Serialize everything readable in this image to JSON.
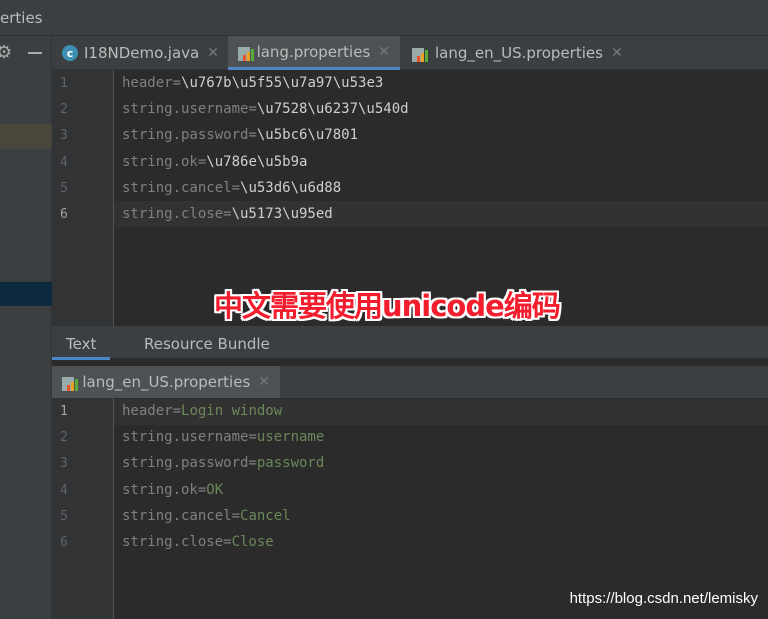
{
  "window": {
    "title": "erties"
  },
  "editor_tabs": [
    {
      "label": "I18NDemo.java",
      "icon": "java-class-icon",
      "active": false
    },
    {
      "label": "lang.properties",
      "icon": "properties-file-icon",
      "active": true
    },
    {
      "label": "lang_en_US.properties",
      "icon": "properties-file-icon",
      "active": false
    }
  ],
  "top_editor": {
    "lines": [
      {
        "n": "1",
        "key": "header=",
        "val": "\\u767b\\u5f55\\u7a97\\u53e3"
      },
      {
        "n": "2",
        "key": "string.username=",
        "val": "\\u7528\\u6237\\u540d"
      },
      {
        "n": "3",
        "key": "string.password=",
        "val": "\\u5bc6\\u7801"
      },
      {
        "n": "4",
        "key": "string.ok=",
        "val": "\\u786e\\u5b9a"
      },
      {
        "n": "5",
        "key": "string.cancel=",
        "val": "\\u53d6\\u6d88"
      },
      {
        "n": "6",
        "key": "string.close=",
        "val": "\\u5173\\u95ed"
      }
    ]
  },
  "bottom_tabs": [
    {
      "label": "Text",
      "active": true
    },
    {
      "label": "Resource Bundle",
      "active": false
    }
  ],
  "bottom_file_tab": {
    "label": "lang_en_US.properties"
  },
  "bottom_editor": {
    "lines": [
      {
        "n": "1",
        "key": "header=",
        "val": "Login window"
      },
      {
        "n": "2",
        "key": "string.username=",
        "val": "username"
      },
      {
        "n": "3",
        "key": "string.password=",
        "val": "password"
      },
      {
        "n": "4",
        "key": "string.ok=",
        "val": "OK"
      },
      {
        "n": "5",
        "key": "string.cancel=",
        "val": "Cancel"
      },
      {
        "n": "6",
        "key": "string.close=",
        "val": "Close"
      }
    ]
  },
  "annotation": "中文需要使用unicode编码",
  "watermark": "https://blog.csdn.net/lemisky",
  "colors": {
    "accent": "#4a88c7",
    "value": "#6a8759",
    "annotation": "#f21d2d"
  }
}
